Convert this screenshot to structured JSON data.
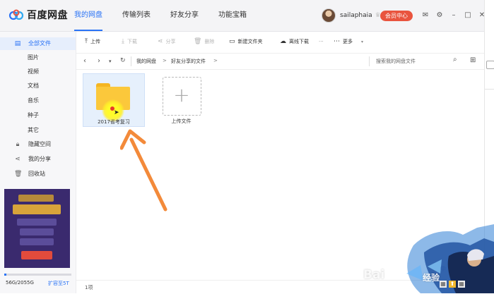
{
  "header": {
    "app_name": "百度网盘",
    "tabs": [
      {
        "label": "我的网盘",
        "active": true
      },
      {
        "label": "传输列表",
        "active": false
      },
      {
        "label": "好友分享",
        "active": false
      },
      {
        "label": "功能宝箱",
        "active": false
      }
    ],
    "username": "sailaphaia",
    "vip_button": "会员中心",
    "icons": [
      "mail-icon",
      "settings-icon",
      "minimize-icon",
      "maximize-icon",
      "close-icon"
    ]
  },
  "sidebar": {
    "items": [
      {
        "label": "全部文件",
        "icon": "file-icon",
        "active": true,
        "sub": false
      },
      {
        "label": "图片",
        "sub": true
      },
      {
        "label": "视频",
        "sub": true
      },
      {
        "label": "文档",
        "sub": true
      },
      {
        "label": "音乐",
        "sub": true
      },
      {
        "label": "种子",
        "sub": true
      },
      {
        "label": "其它",
        "sub": true
      },
      {
        "label": "隐藏空间",
        "icon": "lock-icon",
        "sub": false
      },
      {
        "label": "我的分享",
        "icon": "share-icon",
        "sub": false
      },
      {
        "label": "回收站",
        "icon": "trash-icon",
        "sub": false
      }
    ],
    "quota": {
      "used_fraction": 0.03,
      "text": "56G/2055G",
      "link": "扩容至5T"
    }
  },
  "toolbar": {
    "upload": "上传",
    "download": "下载",
    "share": "分享",
    "delete": "删除",
    "new_folder": "新建文件夹",
    "offline_download": "离线下载",
    "more": "更多"
  },
  "breadcrumb": {
    "items": [
      "我的网盘",
      "好友分享的文件"
    ],
    "separator": ">",
    "search_placeholder": "搜索我的网盘文件"
  },
  "files": [
    {
      "name": "2017省考复习",
      "type": "folder",
      "selected": true
    }
  ],
  "upload_tile_label": "上传文件",
  "status": {
    "count": "1项"
  },
  "colors": {
    "accent": "#2a73f5",
    "vip": "#e9543e",
    "folder": "#fbc83b",
    "arrow": "#f38a3a"
  },
  "watermark": {
    "brand": "Bai",
    "du": "经验",
    "sub": "中"
  }
}
